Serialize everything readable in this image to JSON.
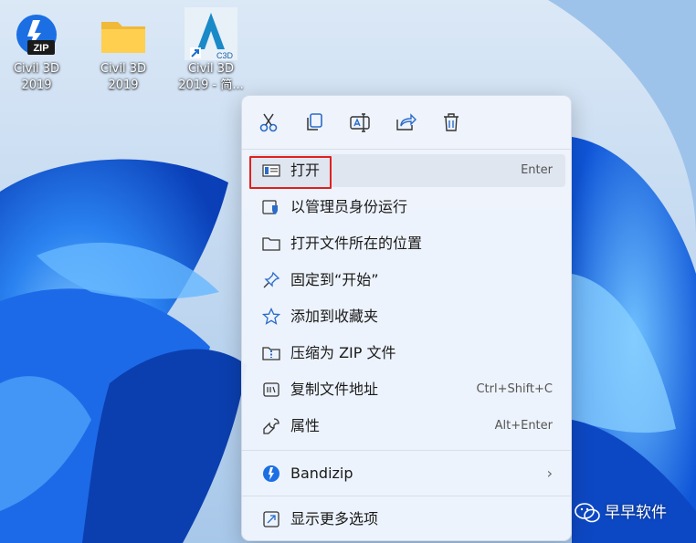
{
  "desktop": {
    "icons": [
      {
        "name": "civil3d-zip",
        "label_line1": "Civil 3D",
        "label_line2": "2019",
        "badge": "ZIP",
        "icon": "zip-archive-icon"
      },
      {
        "name": "civil3d-folder",
        "label_line1": "Civil 3D",
        "label_line2": "2019",
        "icon": "folder-icon"
      },
      {
        "name": "civil3d-shortcut",
        "label_line1": "Civil 3D",
        "label_line2": "2019 - 简...",
        "badge": "C3D",
        "icon": "civil3d-app-icon"
      }
    ]
  },
  "context_menu": {
    "toolbar": [
      {
        "name": "cut",
        "icon": "scissors-icon"
      },
      {
        "name": "copy",
        "icon": "copy-icon"
      },
      {
        "name": "rename",
        "icon": "rename-icon"
      },
      {
        "name": "share",
        "icon": "share-icon"
      },
      {
        "name": "delete",
        "icon": "trash-icon"
      }
    ],
    "items": [
      {
        "label": "打开",
        "shortcut": "Enter",
        "icon": "open-window-icon",
        "highlighted": true
      },
      {
        "label": "以管理员身份运行",
        "shortcut": "",
        "icon": "shield-icon"
      },
      {
        "label": "打开文件所在的位置",
        "shortcut": "",
        "icon": "folder-outline-icon"
      },
      {
        "label": "固定到“开始”",
        "shortcut": "",
        "icon": "pin-icon"
      },
      {
        "label": "添加到收藏夹",
        "shortcut": "",
        "icon": "star-icon"
      },
      {
        "label": "压缩为 ZIP 文件",
        "shortcut": "",
        "icon": "zip-folder-icon"
      },
      {
        "label": "复制文件地址",
        "shortcut": "Ctrl+Shift+C",
        "icon": "copy-path-icon"
      },
      {
        "label": "属性",
        "shortcut": "Alt+Enter",
        "icon": "wrench-icon"
      },
      {
        "label": "Bandizip",
        "shortcut": "",
        "icon": "bandizip-icon",
        "submenu_arrow": "›"
      },
      {
        "label": "显示更多选项",
        "shortcut": "",
        "icon": "more-options-icon"
      }
    ]
  },
  "watermark": {
    "text": "早早软件",
    "icon": "wechat-icon"
  },
  "colors": {
    "highlight_box": "#e0201e",
    "accent_blue": "#0a5fd6"
  }
}
